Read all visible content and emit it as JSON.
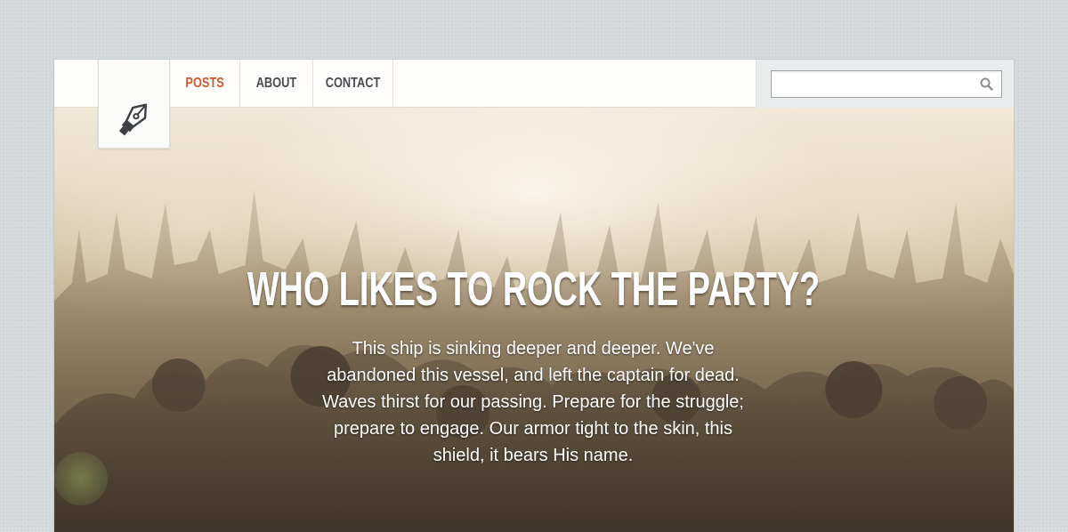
{
  "nav": {
    "items": [
      {
        "label": "POSTS",
        "active": true
      },
      {
        "label": "ABOUT",
        "active": false
      },
      {
        "label": "CONTACT",
        "active": false
      }
    ]
  },
  "search": {
    "placeholder": "",
    "value": ""
  },
  "hero": {
    "title": "WHO LIKES TO ROCK THE PARTY?",
    "text": "This ship is sinking deeper and deeper. We've abandoned this vessel, and left the captain for dead. Waves thirst for our passing. Prepare for the struggle; prepare to engage. Our armor tight to the skin, this shield, it bears His name."
  },
  "icons": {
    "logo": "fountain-pen-icon",
    "search": "magnifier-icon"
  },
  "colors": {
    "accent": "#c85a32",
    "nav_text": "#484c50",
    "background": "#d3d8da"
  }
}
